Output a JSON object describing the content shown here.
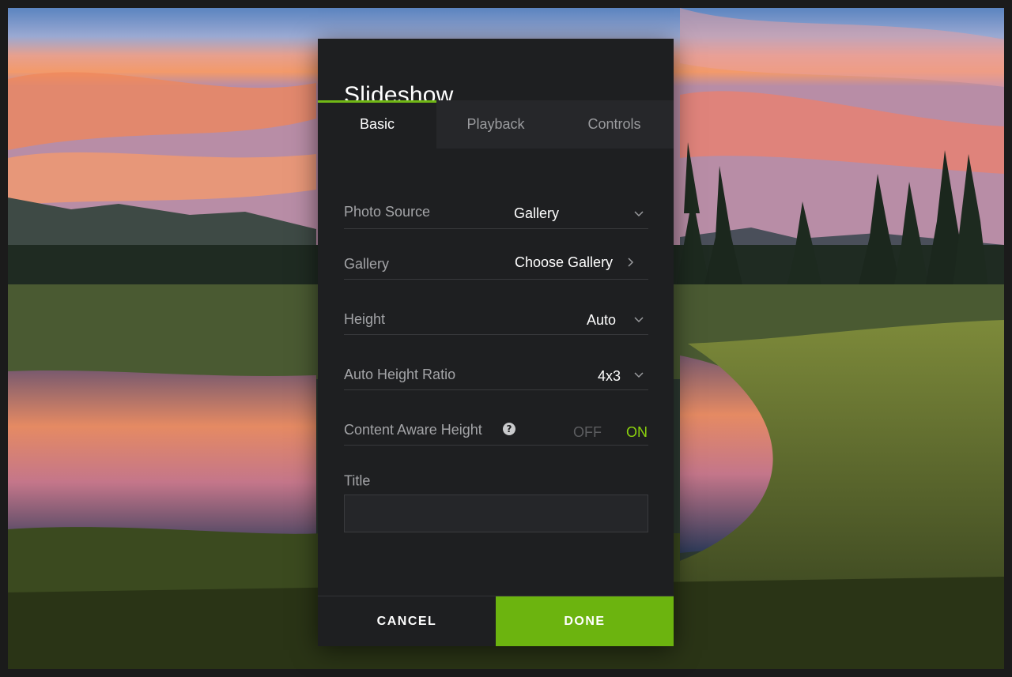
{
  "modal": {
    "title": "Slideshow",
    "tabs": [
      {
        "label": "Basic",
        "active": true
      },
      {
        "label": "Playback",
        "active": false
      },
      {
        "label": "Controls",
        "active": false
      }
    ],
    "fields": {
      "photo_source": {
        "label": "Photo Source",
        "value": "Gallery",
        "icon": "chevron-down-icon"
      },
      "gallery": {
        "label": "Gallery",
        "value": "Choose Gallery",
        "icon": "chevron-right-icon"
      },
      "height": {
        "label": "Height",
        "value": "Auto",
        "icon": "chevron-down-icon"
      },
      "auto_height_ratio": {
        "label": "Auto Height Ratio",
        "value": "4x3",
        "icon": "chevron-down-icon"
      },
      "content_aware_height": {
        "label": "Content Aware Height",
        "help_icon": "question-circle-icon",
        "off_label": "OFF",
        "on_label": "ON",
        "state": "ON"
      }
    },
    "title_field": {
      "label": "Title",
      "value": "",
      "placeholder": ""
    },
    "footer": {
      "cancel_label": "CANCEL",
      "done_label": "DONE"
    }
  },
  "colors": {
    "accent": "#6cb40f",
    "toggle_on": "#8bd10e",
    "modal_bg": "#1e1f21"
  }
}
